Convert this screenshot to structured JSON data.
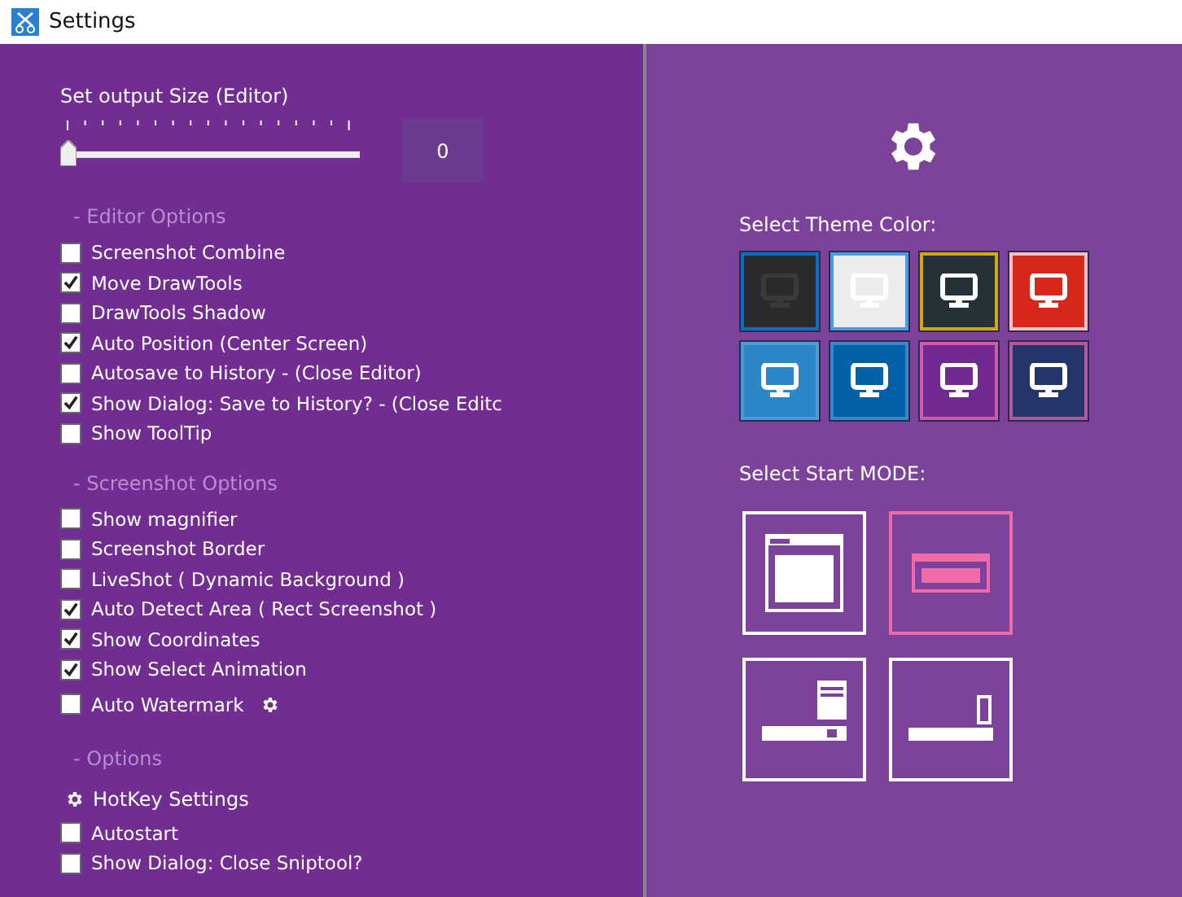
{
  "window": {
    "title": "Settings"
  },
  "output_size": {
    "label": "Set output Size (Editor)",
    "level": 0,
    "value": "0"
  },
  "sections": [
    {
      "heading": "- Editor Options",
      "items": [
        {
          "kind": "checkbox",
          "label": "Screenshot Combine",
          "checked": false
        },
        {
          "kind": "checkbox",
          "label": "Move DrawTools",
          "checked": true
        },
        {
          "kind": "checkbox",
          "label": "DrawTools Shadow",
          "checked": false
        },
        {
          "kind": "checkbox",
          "label": "Auto Position (Center Screen)",
          "checked": true
        },
        {
          "kind": "checkbox",
          "label": "Autosave to History - (Close Editor)",
          "checked": false
        },
        {
          "kind": "checkbox",
          "label": "Show Dialog: Save to History? - (Close Editc",
          "checked": true
        },
        {
          "kind": "checkbox",
          "label": "Show ToolTip",
          "checked": false
        }
      ]
    },
    {
      "heading": "- Screenshot Options",
      "items": [
        {
          "kind": "checkbox",
          "label": "Show magnifier",
          "checked": false
        },
        {
          "kind": "checkbox",
          "label": "Screenshot Border",
          "checked": false
        },
        {
          "kind": "checkbox",
          "label": "LiveShot ( Dynamic Background )",
          "checked": false
        },
        {
          "kind": "checkbox",
          "label": "Auto Detect Area ( Rect Screenshot )",
          "checked": true
        },
        {
          "kind": "checkbox",
          "label": "Show Coordinates",
          "checked": true
        },
        {
          "kind": "checkbox",
          "label": "Show Select Animation",
          "checked": true
        },
        {
          "kind": "checkbox-gear",
          "label": "Auto Watermark",
          "checked": false
        }
      ]
    },
    {
      "heading": "- Options",
      "items": [
        {
          "kind": "gear-link",
          "label": "HotKey Settings"
        },
        {
          "kind": "checkbox",
          "label": "Autostart",
          "checked": false
        },
        {
          "kind": "checkbox",
          "label": "Show Dialog: Close Sniptool?",
          "checked": false
        }
      ]
    }
  ],
  "theme": {
    "label": "Select Theme Color:",
    "swatches": [
      {
        "color": "#2b2b2b"
      },
      {
        "color": "#ececec"
      },
      {
        "color": "#243238"
      },
      {
        "color": "#d6271a"
      },
      {
        "color": "#2c86c8"
      },
      {
        "color": "#0060a8"
      },
      {
        "color": "#722a92"
      },
      {
        "color": "#23356a"
      }
    ]
  },
  "start_mode": {
    "label": "Select Start MODE:",
    "modes": [
      {
        "kind": "window",
        "selected": false
      },
      {
        "kind": "region",
        "selected": true
      },
      {
        "kind": "tray",
        "selected": false
      },
      {
        "kind": "bar",
        "selected": false
      }
    ]
  }
}
